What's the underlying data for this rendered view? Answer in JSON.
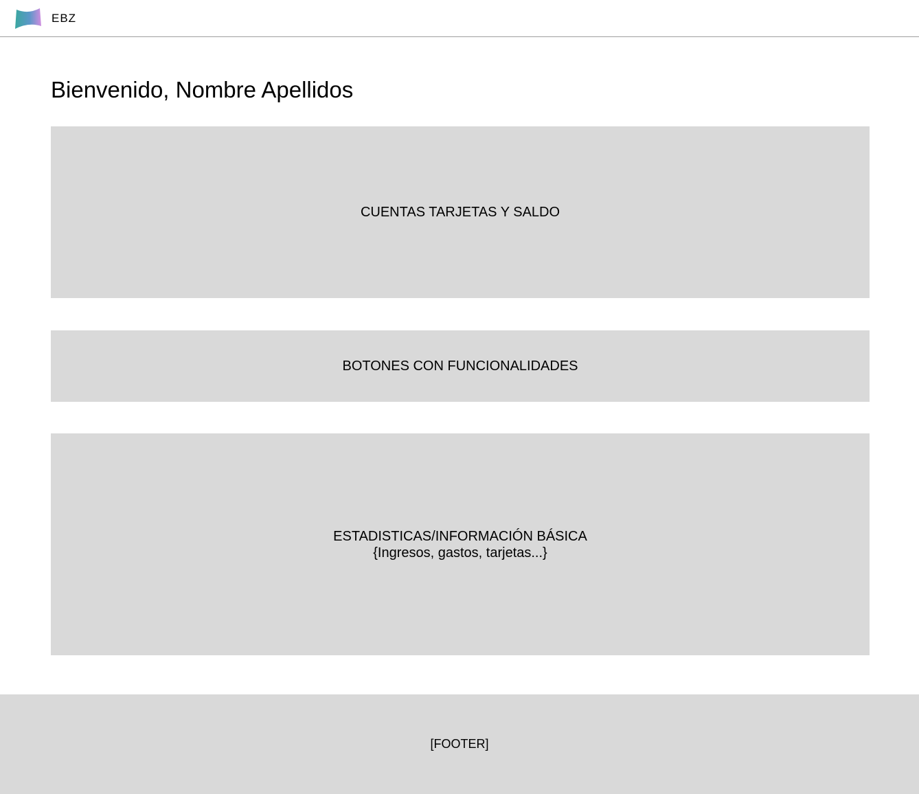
{
  "header": {
    "brand": "EBZ",
    "logo_colors": [
      "#3aa7a0",
      "#5b97c8",
      "#d08de0"
    ]
  },
  "main": {
    "welcome_title": "Bienvenido, Nombre Apellidos",
    "accounts_section": {
      "label": "CUENTAS TARJETAS Y SALDO"
    },
    "buttons_section": {
      "label": "BOTONES CON FUNCIONALIDADES"
    },
    "stats_section": {
      "label": "ESTADISTICAS/INFORMACIÓN BÁSICA",
      "sublabel": "{Ingresos, gastos, tarjetas...}"
    }
  },
  "footer": {
    "label": "[FOOTER]"
  },
  "colors": {
    "placeholder_bg": "#d9d9d9",
    "header_border": "#9e9e9e"
  }
}
